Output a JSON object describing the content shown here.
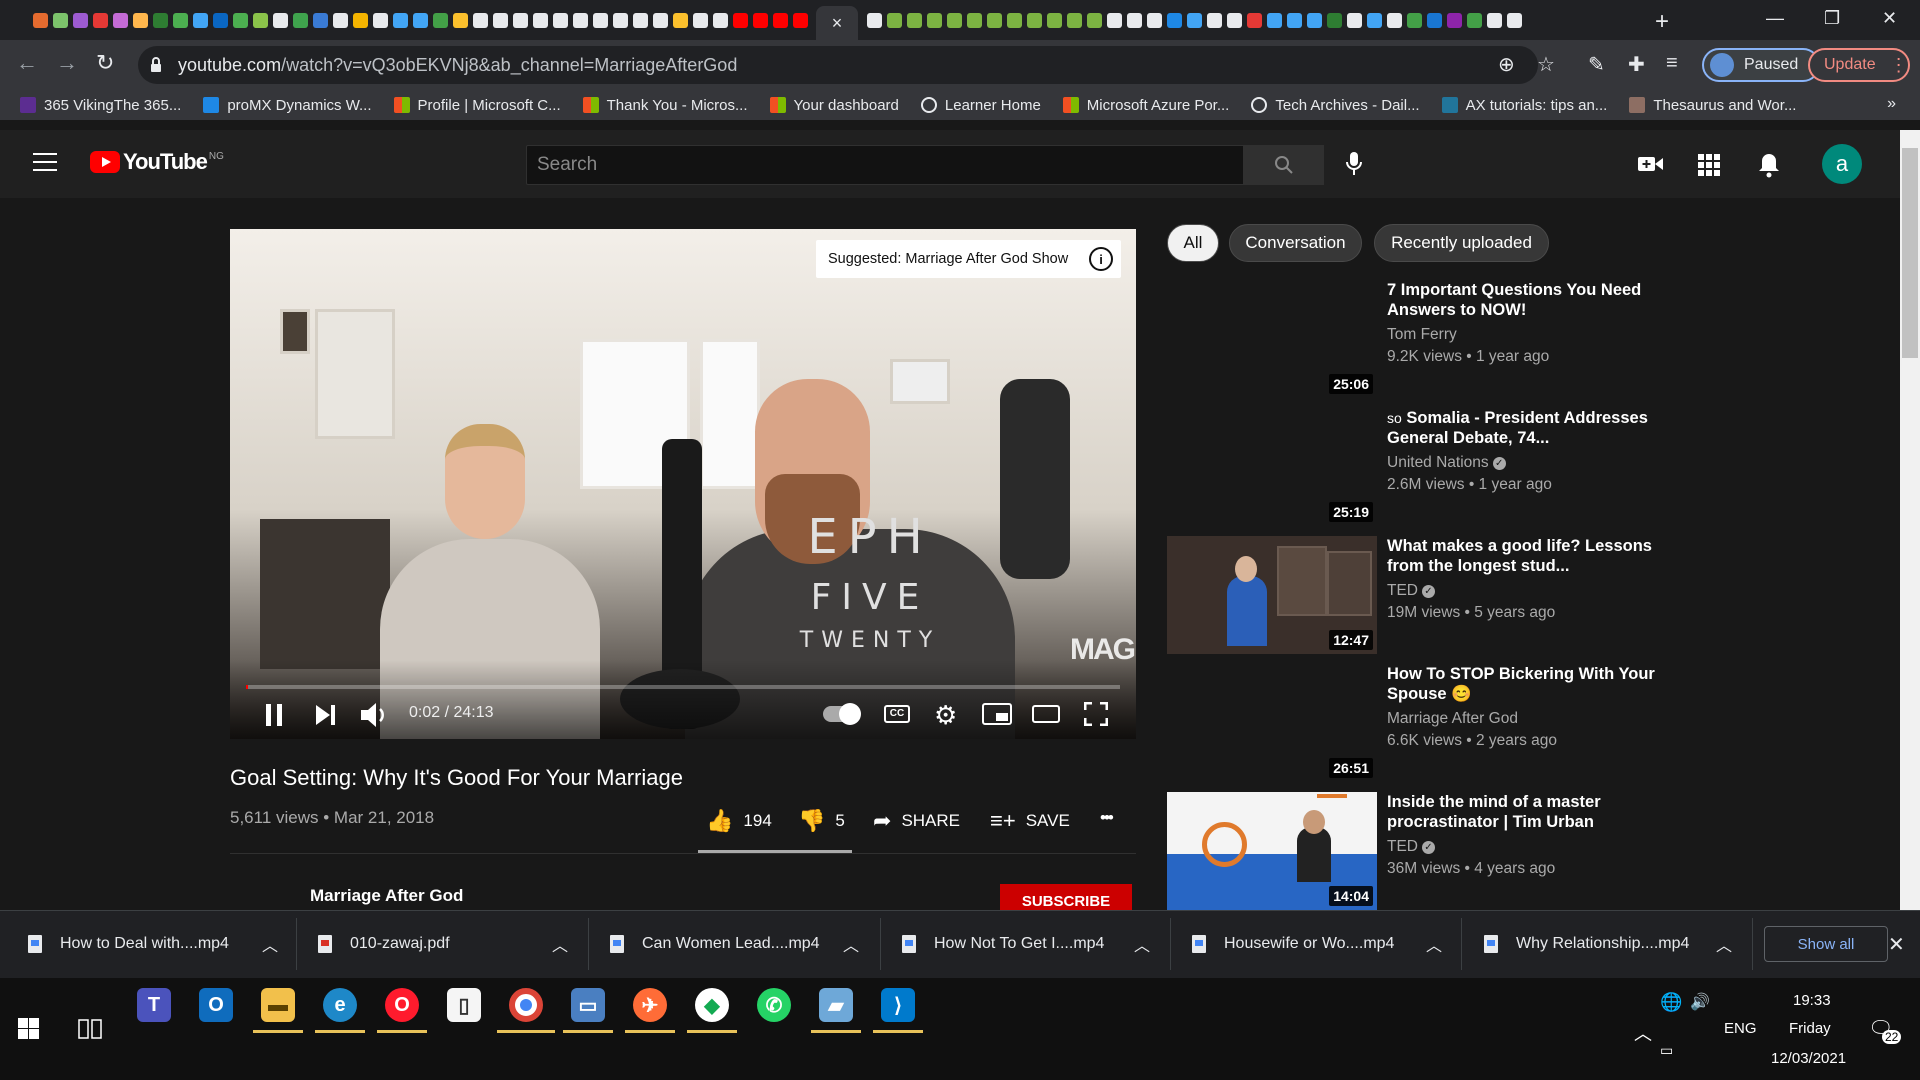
{
  "browser": {
    "active_tab_close": "×",
    "new_tab": "+",
    "window_controls": [
      "—",
      "❐",
      "✕"
    ],
    "url_host": "youtube.com",
    "url_path": "/watch?v=vQ3obEKVNj8&ab_channel=MarriageAfterGod",
    "profile_status": "Paused",
    "update_label": "Update",
    "tab_icon_colors": [
      "#e56b2f",
      "#7cc36b",
      "#9d5bd2",
      "#e53935",
      "#c46bd6",
      "#ffb74d",
      "#2e7d32",
      "#4caf50",
      "#42a5f5",
      "#0a66c2",
      "#4caf50",
      "#8bc34a",
      "#e8eaed",
      "#3fa34d",
      "#3a7bd5",
      "#e8eaed",
      "#f4b400",
      "#e8eaed",
      "#42a5f5",
      "#42a5f5",
      "#43a047",
      "#fbc02d",
      "#e8eaed",
      "#e8eaed",
      "#e8eaed",
      "#e8eaed",
      "#e8eaed",
      "#e8eaed",
      "#e8eaed",
      "#e8eaed",
      "#e8eaed",
      "#e8eaed",
      "#fbc02d",
      "#e8eaed",
      "#e8eaed",
      "#ff0000",
      "#ff0000",
      "#ff0000",
      "#ff0000"
    ],
    "tab_icon_colors_right": [
      "#e8eaed",
      "#7cb342",
      "#7cb342",
      "#7cb342",
      "#7cb342",
      "#7cb342",
      "#7cb342",
      "#7cb342",
      "#7cb342",
      "#7cb342",
      "#7cb342",
      "#7cb342",
      "#e8eaed",
      "#e8eaed",
      "#e8eaed",
      "#1e88e5",
      "#42a5f5",
      "#e8eaed",
      "#e8eaed",
      "#e53935",
      "#42a5f5",
      "#42a5f5",
      "#42a5f5",
      "#2e7d32",
      "#e8eaed",
      "#42a5f5",
      "#e8eaed",
      "#43a047",
      "#1976d2",
      "#8e24aa",
      "#43a047",
      "#e8eaed",
      "#e8eaed"
    ]
  },
  "bookmarks": [
    {
      "label": "365 VikingThe 365...",
      "icon": "viking",
      "color": "#5c2d91"
    },
    {
      "label": "proMX Dynamics W...",
      "icon": "x-mark",
      "color": "#1e88e5"
    },
    {
      "label": "Profile | Microsoft C...",
      "icon": "microsoft",
      "color": ""
    },
    {
      "label": "Thank You - Micros...",
      "icon": "microsoft",
      "color": ""
    },
    {
      "label": "Your dashboard",
      "icon": "microsoft",
      "color": ""
    },
    {
      "label": "Learner Home",
      "icon": "globe",
      "color": ""
    },
    {
      "label": "Microsoft Azure Por...",
      "icon": "microsoft",
      "color": ""
    },
    {
      "label": "Tech Archives - Dail...",
      "icon": "globe",
      "color": ""
    },
    {
      "label": "AX tutorials: tips an...",
      "icon": "wordpress",
      "color": "#21759b"
    },
    {
      "label": "Thesaurus and Wor...",
      "icon": "book",
      "color": "#8d6e63"
    }
  ],
  "bookmarks_more": "»",
  "youtube": {
    "logo_text": "YouTube",
    "country_code": "NG",
    "search_placeholder": "Search",
    "avatar_letter": "a"
  },
  "player": {
    "suggestion": "Suggested: Marriage After God Show",
    "watermark": "MAG",
    "shirt_line1": "EPH",
    "shirt_line2": "FIVE",
    "shirt_line3": "TWENTY",
    "time": "0:02 / 24:13",
    "progress": 0.0014
  },
  "video": {
    "title": "Goal Setting: Why It's Good For Your Marriage",
    "meta": "5,611 views • Mar 21, 2018",
    "likes": "194",
    "dislikes": "5",
    "share_label": "SHARE",
    "save_label": "SAVE",
    "more": "•••",
    "channel": "Marriage After God",
    "subscribe_label": "SUBSCRIBE"
  },
  "chips": [
    {
      "label": "All",
      "active": true
    },
    {
      "label": "Conversation",
      "active": false
    },
    {
      "label": "Recently uploaded",
      "active": false
    }
  ],
  "recommendations": [
    {
      "title": "7 Important Questions You Need Answers to NOW!",
      "channel": "Tom Ferry",
      "verified": false,
      "meta": "9.2K views • 1 year ago",
      "duration": "25:06",
      "thumb": "none"
    },
    {
      "title": "Somalia - President Addresses General Debate, 74...",
      "channel": "United Nations",
      "verified": true,
      "meta": "2.6M views • 1 year ago",
      "duration": "25:19",
      "thumb": "none",
      "prefix": "so"
    },
    {
      "title": "What makes a good life? Lessons from the longest stud...",
      "channel": "TED",
      "verified": true,
      "meta": "19M views • 5 years ago",
      "duration": "12:47",
      "thumb": "ted-talk"
    },
    {
      "title": "How To STOP Bickering With Your Spouse 😊",
      "channel": "Marriage After God",
      "verified": false,
      "meta": "6.6K views • 2 years ago",
      "duration": "26:51",
      "thumb": "none"
    },
    {
      "title": "Inside the mind of a master procrastinator | Tim Urban",
      "channel": "TED",
      "verified": true,
      "meta": "36M views • 4 years ago",
      "duration": "14:04",
      "thumb": "ted-procrastinator"
    }
  ],
  "downloads": [
    {
      "label": "How to Deal with....mp4",
      "type": "video"
    },
    {
      "label": "010-zawaj.pdf",
      "type": "pdf"
    },
    {
      "label": "Can Women Lead....mp4",
      "type": "video"
    },
    {
      "label": "How Not To Get I....mp4",
      "type": "video"
    },
    {
      "label": "Housewife or Wo....mp4",
      "type": "video"
    },
    {
      "label": "Why Relationship....mp4",
      "type": "video"
    }
  ],
  "downloads_show_all": "Show all",
  "taskbar": {
    "apps": [
      "teams",
      "outlook",
      "file-explorer",
      "edge",
      "opera",
      "notepad",
      "chrome",
      "remote-desktop",
      "postman",
      "mongodb-compass",
      "whatsapp",
      "azure-data-studio",
      "vscode"
    ],
    "language": "ENG",
    "time": "19:33",
    "day": "Friday",
    "date": "12/03/2021",
    "notifications": "22"
  }
}
